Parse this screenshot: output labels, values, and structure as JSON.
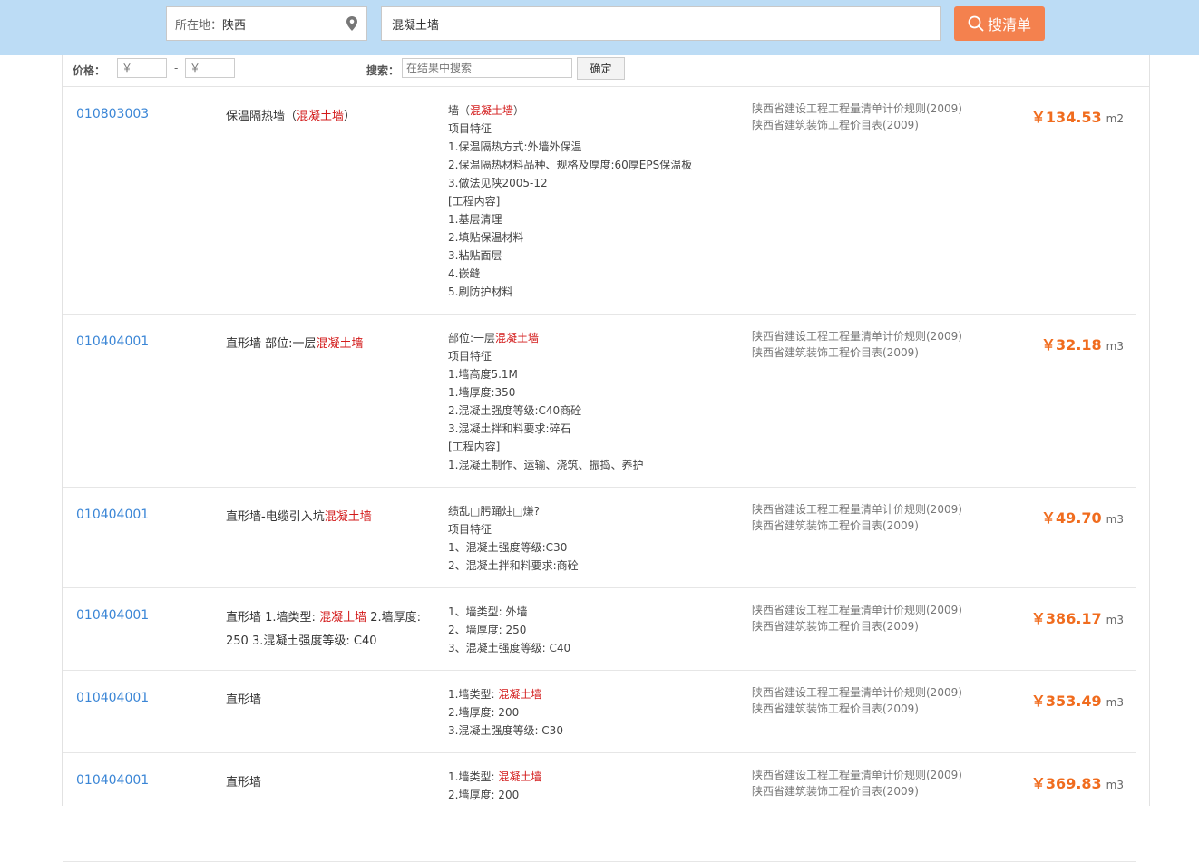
{
  "header": {
    "location_label": "所在地：",
    "location_value": "陕西",
    "search_query": "混凝土墙",
    "search_button_label": "搜清单"
  },
  "filter": {
    "price_label": "价格：",
    "price_min_placeholder": "￥",
    "price_max_placeholder": "￥",
    "dash": "-",
    "search_label": "搜索：",
    "search_placeholder": "在结果中搜索",
    "confirm_label": "确定"
  },
  "results": [
    {
      "code": "010803003",
      "name": [
        {
          "t": "保温隔热墙（"
        },
        {
          "t": "混凝土墙",
          "hl": true
        },
        {
          "t": "）"
        }
      ],
      "desc": [
        [
          {
            "t": "墙（"
          },
          {
            "t": "混凝土墙",
            "hl": true
          },
          {
            "t": "）"
          }
        ],
        [
          {
            "t": "项目特征"
          }
        ],
        [
          {
            "t": "1.保温隔热方式:外墙外保温"
          }
        ],
        [
          {
            "t": "2.保温隔热材料品种、规格及厚度:60厚EPS保温板"
          }
        ],
        [
          {
            "t": "3.做法见陕2005-12"
          }
        ],
        [
          {
            "t": "[工程内容]"
          }
        ],
        [
          {
            "t": "1.基层清理"
          }
        ],
        [
          {
            "t": "2.填贴保温材料"
          }
        ],
        [
          {
            "t": "3.粘贴面层"
          }
        ],
        [
          {
            "t": "4.嵌缝"
          }
        ],
        [
          {
            "t": "5.刷防护材料"
          }
        ]
      ],
      "rules": [
        "陕西省建设工程工程量清单计价规则(2009)",
        "陕西省建筑装饰工程价目表(2009)"
      ],
      "price": "￥134.53",
      "unit": "m2"
    },
    {
      "code": "010404001",
      "name": [
        {
          "t": "直形墙 部位:一层"
        },
        {
          "t": "混凝土墙",
          "hl": true
        }
      ],
      "desc": [
        [
          {
            "t": "部位:一层"
          },
          {
            "t": "混凝土墙",
            "hl": true
          }
        ],
        [
          {
            "t": "项目特征"
          }
        ],
        [
          {
            "t": "1.墙高度5.1M"
          }
        ],
        [
          {
            "t": "1.墙厚度:350"
          }
        ],
        [
          {
            "t": "2.混凝土强度等级:C40商砼"
          }
        ],
        [
          {
            "t": "3.混凝土拌和料要求:碎石"
          }
        ],
        [
          {
            "t": "[工程内容]"
          }
        ],
        [
          {
            "t": "1.混凝土制作、运输、浇筑、振捣、养护"
          }
        ]
      ],
      "rules": [
        "陕西省建设工程工程量清单计价规则(2009)",
        "陕西省建筑装饰工程价目表(2009)"
      ],
      "price": "￥32.18",
      "unit": "m3"
    },
    {
      "code": "010404001",
      "name": [
        {
          "t": "直形墙-电缆引入坑"
        },
        {
          "t": "混凝土墙",
          "hl": true
        }
      ],
      "desc": [
        [
          {
            "t": "绩乱□肟踊炷□熑?"
          }
        ],
        [
          {
            "t": "项目特征"
          }
        ],
        [
          {
            "t": "1、混凝土强度等级:C30"
          }
        ],
        [
          {
            "t": "2、混凝土拌和料要求:商砼"
          }
        ]
      ],
      "rules": [
        "陕西省建设工程工程量清单计价规则(2009)",
        "陕西省建筑装饰工程价目表(2009)"
      ],
      "price": "￥49.70",
      "unit": "m3"
    },
    {
      "code": "010404001",
      "name": [
        {
          "t": "直形墙 1.墙类型: "
        },
        {
          "t": "混凝土墙",
          "hl": true
        },
        {
          "t": " 2.墙厚度: 250 3.混凝土强度等级: C40"
        }
      ],
      "desc": [
        [
          {
            "t": "1、墙类型: 外墙"
          }
        ],
        [
          {
            "t": "2、墙厚度: 250"
          }
        ],
        [
          {
            "t": "3、混凝土强度等级: C40"
          }
        ]
      ],
      "rules": [
        "陕西省建设工程工程量清单计价规则(2009)",
        "陕西省建筑装饰工程价目表(2009)"
      ],
      "price": "￥386.17",
      "unit": "m3"
    },
    {
      "code": "010404001",
      "name": [
        {
          "t": "直形墙"
        }
      ],
      "desc": [
        [
          {
            "t": "1.墙类型: "
          },
          {
            "t": "混凝土墙",
            "hl": true
          }
        ],
        [
          {
            "t": "2.墙厚度: 200"
          }
        ],
        [
          {
            "t": "3.混凝土强度等级: C30"
          }
        ]
      ],
      "rules": [
        "陕西省建设工程工程量清单计价规则(2009)",
        "陕西省建筑装饰工程价目表(2009)"
      ],
      "price": "￥353.49",
      "unit": "m3"
    },
    {
      "code": "010404001",
      "name": [
        {
          "t": "直形墙"
        }
      ],
      "desc": [
        [
          {
            "t": "1.墙类型: "
          },
          {
            "t": "混凝土墙",
            "hl": true
          }
        ],
        [
          {
            "t": "2.墙厚度: 200"
          }
        ]
      ],
      "rules": [
        "陕西省建设工程工程量清单计价规则(2009)",
        "陕西省建筑装饰工程价目表(2009)"
      ],
      "price": "￥369.83",
      "unit": "m3"
    }
  ],
  "colors": {
    "header_bg": "#bcdcf5",
    "search_button": "#f4814e",
    "code_link": "#3b86d6",
    "highlight": "#d31b1b",
    "price": "#f06c1e"
  },
  "icons": {
    "location": "map-pin-icon",
    "search": "search-icon"
  }
}
